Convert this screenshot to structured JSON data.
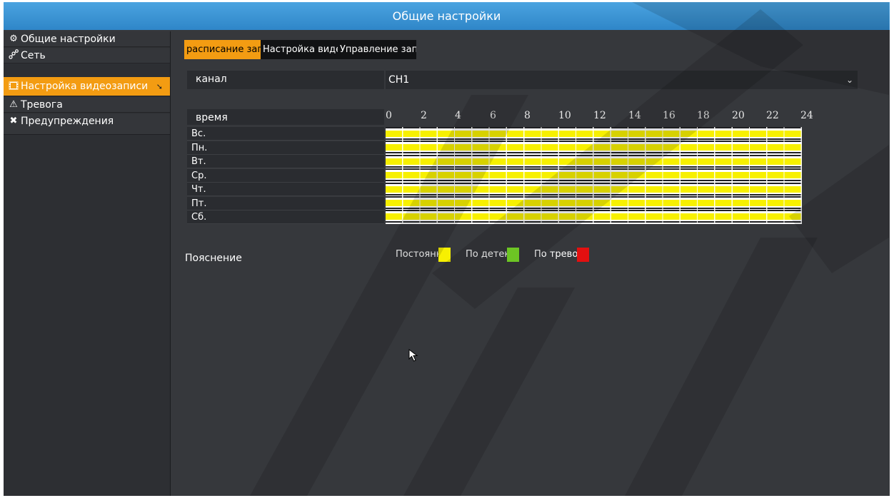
{
  "window": {
    "title": "Общие настройки"
  },
  "sidebar": {
    "items": [
      {
        "label": "Общие настройки",
        "icon": "gear-icon"
      },
      {
        "label": "Сеть",
        "icon": "network-icon"
      },
      {
        "label": "Настройка видеозаписи",
        "icon": "film-icon",
        "active": true
      },
      {
        "label": "Тревога",
        "icon": "warning-icon"
      },
      {
        "label": "Предупреждения",
        "icon": "tools-icon"
      }
    ]
  },
  "tabs": [
    {
      "label": "расписание записи",
      "active": true
    },
    {
      "label": "Настройка видео"
    },
    {
      "label": "Управление записью"
    }
  ],
  "channel": {
    "label": "канал",
    "value": "CH1"
  },
  "schedule": {
    "time_label": "время",
    "hours": [
      "0",
      "2",
      "4",
      "6",
      "8",
      "10",
      "12",
      "14",
      "16",
      "18",
      "20",
      "22",
      "24"
    ],
    "days": [
      "Вс.",
      "Пн.",
      "Вт.",
      "Ср.",
      "Чт.",
      "Пт.",
      "Сб."
    ]
  },
  "legend": {
    "label": "Пояснение",
    "items": [
      {
        "label": "Постоянная",
        "color": "#f7f001"
      },
      {
        "label": "По детекции",
        "color": "#7ee32a"
      },
      {
        "label": "По тревоге",
        "color": "#e31010"
      }
    ]
  },
  "colors": {
    "accent": "#f39c12",
    "titlebar": "#2f86c8",
    "background": "#36383c"
  }
}
